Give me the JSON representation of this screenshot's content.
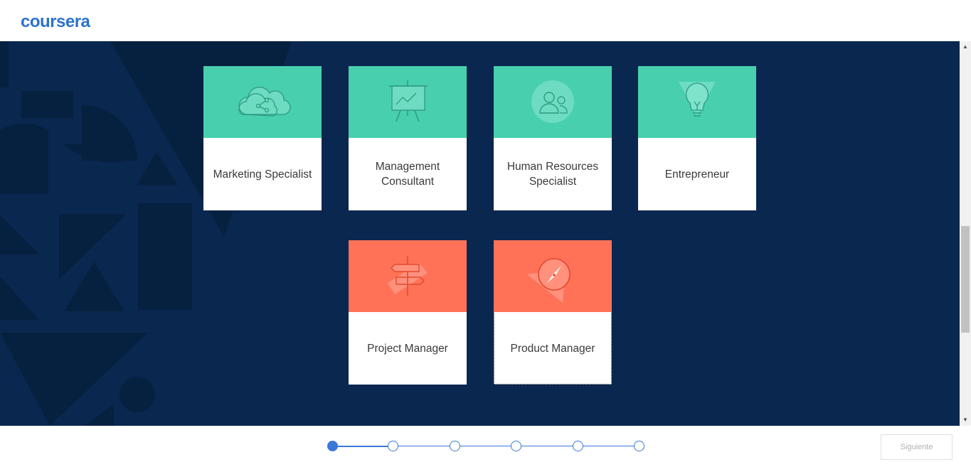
{
  "app": {
    "logo_text": "coursera",
    "brand_color": "#2a73cc"
  },
  "colors": {
    "background": "#0a274f",
    "card_green": "#48cfad",
    "card_coral": "#ff7257",
    "step_accent": "#3a78d8"
  },
  "cards": [
    {
      "label": "Marketing Specialist",
      "icon": "cloud-share-icon",
      "color": "green"
    },
    {
      "label": "Management Consultant",
      "icon": "presentation-board-icon",
      "color": "green"
    },
    {
      "label": "Human Resources Specialist",
      "icon": "people-icon",
      "color": "green"
    },
    {
      "label": "Entrepreneur",
      "icon": "lightbulb-icon",
      "color": "green"
    },
    {
      "label": "Project Manager",
      "icon": "signpost-icon",
      "color": "coral"
    },
    {
      "label": "Product Manager",
      "icon": "compass-icon",
      "color": "coral"
    }
  ],
  "stepper": {
    "total_steps": 6,
    "current_step": 1
  },
  "footer": {
    "next_label": "Siguiente"
  }
}
